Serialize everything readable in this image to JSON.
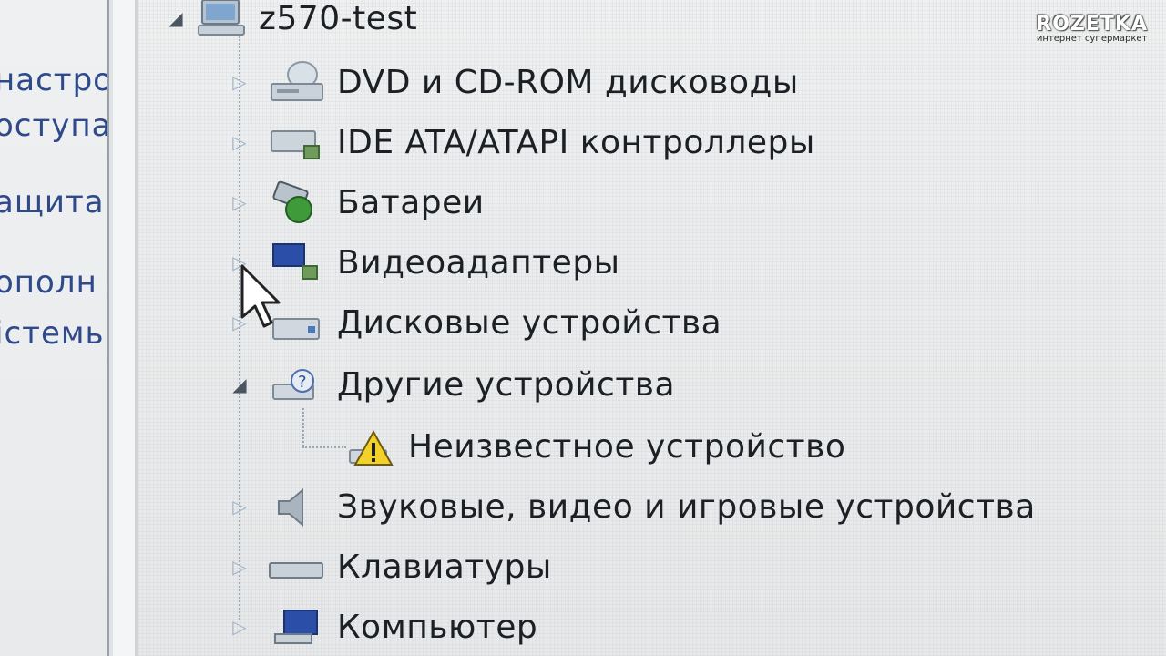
{
  "left_pane": {
    "items": [
      "настро",
      "оступа",
      "ащита",
      "ополн",
      "істемь"
    ]
  },
  "tree": {
    "root": "z570-test",
    "categories": [
      {
        "label": "DVD и CD-ROM дисководы",
        "icon": "dvd-drive-icon",
        "expanded": false
      },
      {
        "label": "IDE ATA/ATAPI контроллеры",
        "icon": "ide-controller-icon",
        "expanded": false
      },
      {
        "label": "Батареи",
        "icon": "battery-icon",
        "expanded": false
      },
      {
        "label": "Видеоадаптеры",
        "icon": "display-adapter-icon",
        "expanded": false
      },
      {
        "label": "Дисковые устройства",
        "icon": "disk-drive-icon",
        "expanded": false
      },
      {
        "label": "Другие устройства",
        "icon": "other-devices-icon",
        "expanded": true
      },
      {
        "label": "Неизвестное устройство",
        "icon": "warning-device-icon",
        "child": true
      },
      {
        "label": "Звуковые, видео и игровые устройства",
        "icon": "speaker-icon",
        "expanded": false
      },
      {
        "label": "Клавиатуры",
        "icon": "keyboard-icon",
        "expanded": false
      },
      {
        "label": "Компьютер",
        "icon": "computer-icon",
        "expanded": false
      }
    ]
  },
  "watermark": {
    "title": "ROZETKA",
    "subtitle": "интернет супермаркет"
  }
}
